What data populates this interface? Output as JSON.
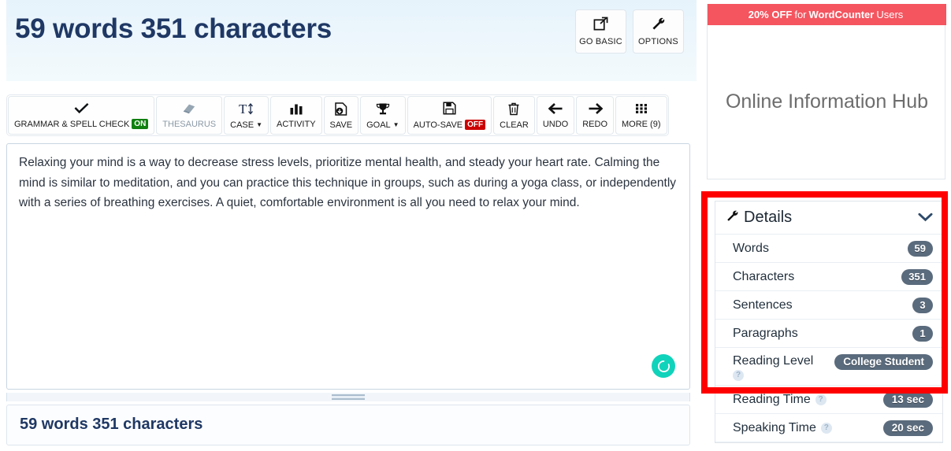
{
  "header": {
    "count_title": "59 words 351 characters",
    "buttons": [
      {
        "label": "GO BASIC",
        "icon": "external-link-icon",
        "glyph": "↗"
      },
      {
        "label": "OPTIONS",
        "icon": "wrench-icon",
        "glyph": "🔧"
      }
    ]
  },
  "toolbar": {
    "items": [
      {
        "name": "grammar-spell-check",
        "label": "GRAMMAR & SPELL CHECK",
        "icon": "check-icon",
        "glyph": "✔",
        "badge": "ON",
        "badge_state": "on",
        "muted": false
      },
      {
        "name": "thesaurus",
        "label": "THESAURUS",
        "icon": "book-icon",
        "glyph": "📓",
        "badge": "",
        "badge_state": "",
        "muted": true
      },
      {
        "name": "case",
        "label": "CASE",
        "icon": "text-case-icon",
        "glyph": "T↕",
        "badge": "",
        "badge_state": "",
        "caret": true,
        "muted": false
      },
      {
        "name": "activity",
        "label": "ACTIVITY",
        "icon": "bar-chart-icon",
        "glyph": "█",
        "badge": "",
        "badge_state": "",
        "muted": false
      },
      {
        "name": "save",
        "label": "SAVE",
        "icon": "save-file-icon",
        "glyph": "🖫",
        "badge": "",
        "badge_state": "",
        "muted": false
      },
      {
        "name": "goal",
        "label": "GOAL",
        "icon": "trophy-icon",
        "glyph": "🏆",
        "badge": "",
        "badge_state": "",
        "caret": true,
        "muted": false
      },
      {
        "name": "auto-save",
        "label": "AUTO-SAVE",
        "icon": "floppy-disk-icon",
        "glyph": "💾",
        "badge": "OFF",
        "badge_state": "off",
        "muted": false
      },
      {
        "name": "clear",
        "label": "CLEAR",
        "icon": "trash-icon",
        "glyph": "🗑",
        "badge": "",
        "badge_state": "",
        "muted": false
      },
      {
        "name": "undo",
        "label": "UNDO",
        "icon": "arrow-left-icon",
        "glyph": "←",
        "badge": "",
        "badge_state": "",
        "muted": false
      },
      {
        "name": "redo",
        "label": "REDO",
        "icon": "arrow-right-icon",
        "glyph": "→",
        "badge": "",
        "badge_state": "",
        "muted": false
      },
      {
        "name": "more",
        "label": "MORE (9)",
        "icon": "grid-dots-icon",
        "glyph": "⁙",
        "badge": "",
        "badge_state": "",
        "muted": false
      }
    ]
  },
  "editor": {
    "text": "Relaxing your mind is a way to decrease stress levels, prioritize mental health, and steady your heart rate. Calming the mind is similar to meditation, and you can practice this technique in groups, such as during a yoga class, or independently with a series of breathing exercises. A quiet, comfortable environment is all you need to relax your mind.",
    "status_icon": "loading-spinner-icon",
    "status_color": "#10d3bb"
  },
  "footer": {
    "count_text": "59 words 351 characters"
  },
  "sidebar": {
    "ad": {
      "banner_bold_1": "20% OFF",
      "banner_normal": "for",
      "banner_bold_2": "WordCounter",
      "banner_tail": "Users",
      "headline": "Online Information Hub",
      "banner_color": "#f4555f"
    },
    "details": {
      "title": "Details",
      "icon": "wrench-icon",
      "collapse_icon": "chevron-down-icon",
      "rows": [
        {
          "label": "Words",
          "value": "59",
          "help": false,
          "wide": false
        },
        {
          "label": "Characters",
          "value": "351",
          "help": false,
          "wide": false
        },
        {
          "label": "Sentences",
          "value": "3",
          "help": false,
          "wide": false
        },
        {
          "label": "Paragraphs",
          "value": "1",
          "help": false,
          "wide": false
        },
        {
          "label": "Reading Level",
          "value": "College Student",
          "help": true,
          "wide": true
        },
        {
          "label": "Reading Time",
          "value": "13 sec",
          "help": true,
          "wide": true
        },
        {
          "label": "Speaking Time",
          "value": "20 sec",
          "help": true,
          "wide": true
        }
      ]
    }
  },
  "annotation": {
    "highlight_color": "#ff0000"
  }
}
